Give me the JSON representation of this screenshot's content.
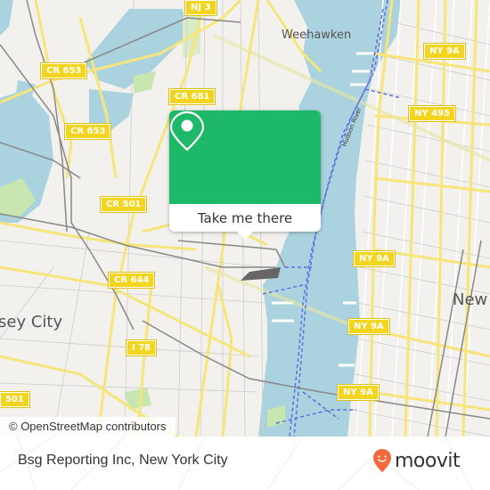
{
  "map": {
    "road_labels": [
      {
        "id": "nj3",
        "text": "NJ 3"
      },
      {
        "id": "cr653a",
        "text": "CR 653"
      },
      {
        "id": "cr653b",
        "text": "CR 653"
      },
      {
        "id": "cr681",
        "text": "CR 681"
      },
      {
        "id": "cr501",
        "text": "CR 501"
      },
      {
        "id": "cr644",
        "text": "CR 644"
      },
      {
        "id": "i78",
        "text": "I 78"
      },
      {
        "id": "c501",
        "text": "501"
      },
      {
        "id": "ny9a1",
        "text": "NY 9A"
      },
      {
        "id": "ny495",
        "text": "NY 495"
      },
      {
        "id": "ny9a2",
        "text": "NY 9A"
      },
      {
        "id": "ny9a3",
        "text": "NY 9A"
      },
      {
        "id": "ny9a4",
        "text": "NY 9A"
      }
    ],
    "place_labels": {
      "weehawken": "Weehawken",
      "jersey_city": "sey City",
      "new_york": "New",
      "river": "Hudson River"
    },
    "attribution": "© OpenStreetMap contributors",
    "popup": {
      "icon": "map-pin-icon",
      "button_label": "Take me there",
      "color": "#1eb869"
    }
  },
  "footer": {
    "title": "Bsg Reporting Inc, New York City",
    "brand": "moovit",
    "brand_color": "#f26a3d"
  }
}
